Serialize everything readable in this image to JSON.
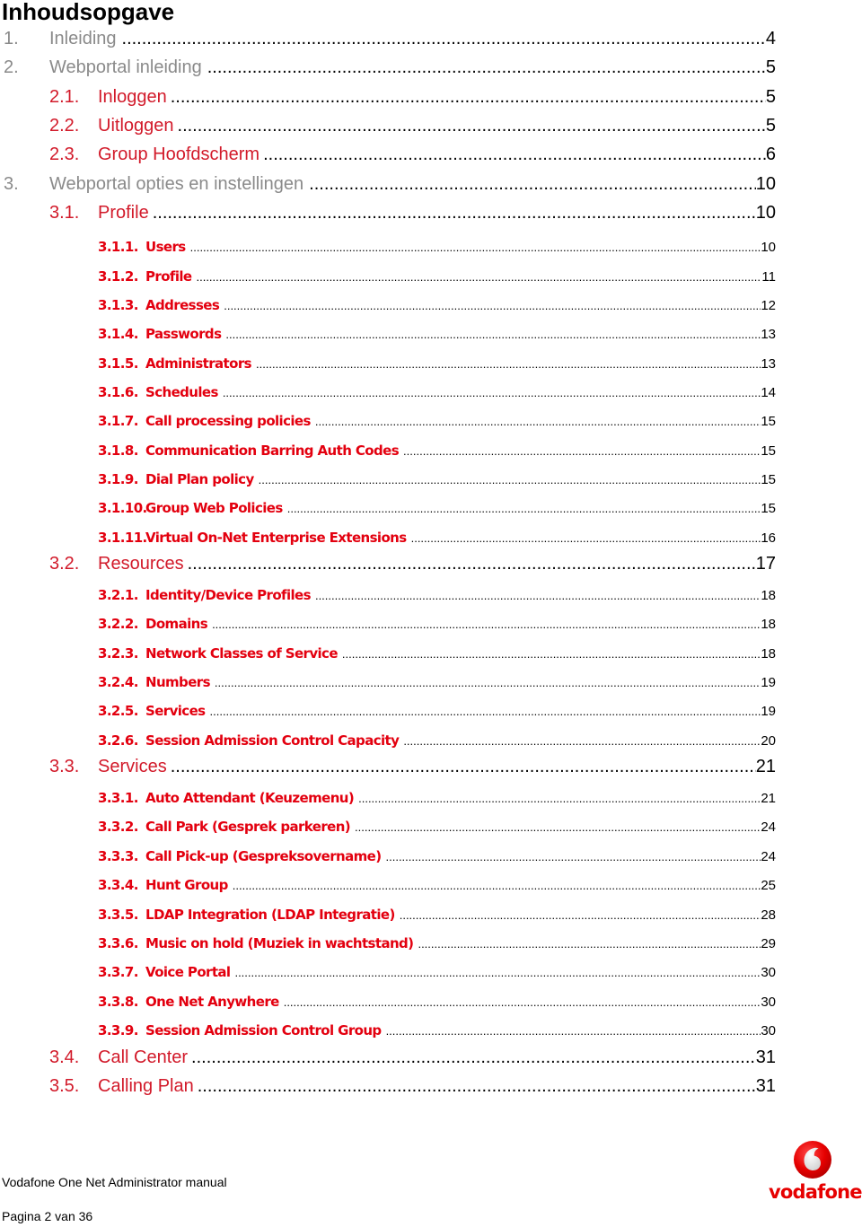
{
  "page": {
    "title": "Inhoudsopgave",
    "colors": {
      "level1_text": "#8a8a8a",
      "level2_text": "#d21a2a",
      "level3_text": "#e3000f",
      "page_number": "#000000",
      "brand": "#e60000"
    }
  },
  "toc": [
    {
      "level": 1,
      "number": "1.",
      "label": "Inleiding",
      "page": "4"
    },
    {
      "level": 1,
      "number": "2.",
      "label": "Webportal inleiding",
      "page": "5"
    },
    {
      "level": 2,
      "number": "2.1.",
      "label": "Inloggen",
      "page": "5"
    },
    {
      "level": 2,
      "number": "2.2.",
      "label": "Uitloggen",
      "page": "5"
    },
    {
      "level": 2,
      "number": "2.3.",
      "label": "Group Hoofdscherm",
      "page": "6"
    },
    {
      "level": 1,
      "number": "3.",
      "label": "Webportal opties en instellingen",
      "page": "10"
    },
    {
      "level": 2,
      "number": "3.1.",
      "label": "Profile",
      "page": "10"
    },
    {
      "level": 3,
      "number": "3.1.1.",
      "label": "Users",
      "page": "10"
    },
    {
      "level": 3,
      "number": "3.1.2.",
      "label": "Profile",
      "page": "11"
    },
    {
      "level": 3,
      "number": "3.1.3.",
      "label": "Addresses",
      "page": "12"
    },
    {
      "level": 3,
      "number": "3.1.4.",
      "label": "Passwords",
      "page": "13"
    },
    {
      "level": 3,
      "number": "3.1.5.",
      "label": "Administrators",
      "page": "13"
    },
    {
      "level": 3,
      "number": "3.1.6.",
      "label": "Schedules",
      "page": "14"
    },
    {
      "level": 3,
      "number": "3.1.7.",
      "label": "Call processing policies",
      "page": "15"
    },
    {
      "level": 3,
      "number": "3.1.8.",
      "label": "Communication Barring Auth Codes",
      "page": "15"
    },
    {
      "level": 3,
      "number": "3.1.9.",
      "label": "Dial Plan policy",
      "page": "15"
    },
    {
      "level": 3,
      "number": "3.1.10.",
      "label": "Group Web Policies",
      "page": "15"
    },
    {
      "level": 3,
      "number": "3.1.11.",
      "label": "Virtual On-Net Enterprise Extensions",
      "page": "16"
    },
    {
      "level": 2,
      "number": "3.2.",
      "label": "Resources",
      "page": "17"
    },
    {
      "level": 3,
      "number": "3.2.1.",
      "label": "Identity/Device Profiles",
      "page": "18"
    },
    {
      "level": 3,
      "number": "3.2.2.",
      "label": "Domains",
      "page": "18"
    },
    {
      "level": 3,
      "number": "3.2.3.",
      "label": "Network Classes of Service",
      "page": "18"
    },
    {
      "level": 3,
      "number": "3.2.4.",
      "label": "Numbers",
      "page": "19"
    },
    {
      "level": 3,
      "number": "3.2.5.",
      "label": "Services",
      "page": "19"
    },
    {
      "level": 3,
      "number": "3.2.6.",
      "label": "Session Admission Control Capacity",
      "page": "20"
    },
    {
      "level": 2,
      "number": "3.3.",
      "label": "Services",
      "page": "21"
    },
    {
      "level": 3,
      "number": "3.3.1.",
      "label": "Auto Attendant (Keuzemenu)",
      "page": "21"
    },
    {
      "level": 3,
      "number": "3.3.2.",
      "label": "Call Park (Gesprek parkeren)",
      "page": "24"
    },
    {
      "level": 3,
      "number": "3.3.3.",
      "label": "Call Pick-up (Gespreksovername)",
      "page": "24"
    },
    {
      "level": 3,
      "number": "3.3.4.",
      "label": "Hunt Group",
      "page": "25"
    },
    {
      "level": 3,
      "number": "3.3.5.",
      "label": "LDAP Integration (LDAP Integratie)",
      "page": "28"
    },
    {
      "level": 3,
      "number": "3.3.6.",
      "label": "Music on hold (Muziek in wachtstand)",
      "page": "29"
    },
    {
      "level": 3,
      "number": "3.3.7.",
      "label": "Voice Portal",
      "page": "30"
    },
    {
      "level": 3,
      "number": "3.3.8.",
      "label": "One Net Anywhere",
      "page": "30"
    },
    {
      "level": 3,
      "number": "3.3.9.",
      "label": "Session Admission Control Group",
      "page": "30"
    },
    {
      "level": 2,
      "number": "3.4.",
      "label": "Call Center",
      "page": "31"
    },
    {
      "level": 2,
      "number": "3.5.",
      "label": "Calling Plan",
      "page": "31"
    }
  ],
  "footer": {
    "document_title": "Vodafone One Net Administrator manual",
    "page_indicator": "Pagina 2 van 36",
    "logo": {
      "icon": "vodafone-speechmark-icon",
      "wordmark": "vodafone"
    }
  }
}
